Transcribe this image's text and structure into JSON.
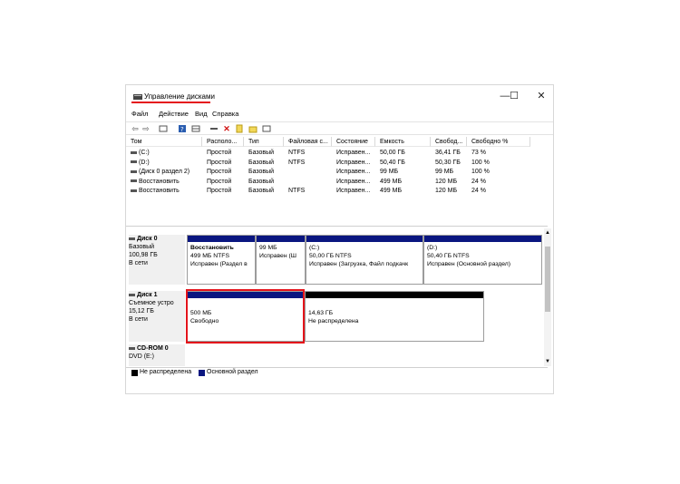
{
  "window": {
    "title": "Управление дисками",
    "controls": [
      "—",
      "☐",
      "✕"
    ]
  },
  "menu": [
    "Файл",
    "Действие",
    "Вид",
    "Справка"
  ],
  "toolbar": [
    "back-icon",
    "forward-icon",
    "properties-icon",
    "help-icon",
    "disk-list-icon",
    "connect-icon",
    "delete-icon",
    "new-icon",
    "folder-icon",
    "view-icon"
  ],
  "volume_table": {
    "headers": [
      "Том",
      "Располо...",
      "Тип",
      "Файловая с...",
      "Состояние",
      "Емкость",
      "Свобод...",
      "Свободно %"
    ],
    "rows": [
      [
        "(C:)",
        "Простой",
        "Базовый",
        "NTFS",
        "Исправен...",
        "50,00 ГБ",
        "36,41 ГБ",
        "73 %"
      ],
      [
        "(D:)",
        "Простой",
        "Базовый",
        "NTFS",
        "Исправен...",
        "50,40 ГБ",
        "50,30 ГБ",
        "100 %"
      ],
      [
        "(Диск 0 раздел 2)",
        "Простой",
        "Базовый",
        "",
        "Исправен...",
        "99 МБ",
        "99 МБ",
        "100 %"
      ],
      [
        "Восстановить",
        "Простой",
        "Базовый",
        "",
        "Исправен...",
        "499 МБ",
        "120 МБ",
        "24 %"
      ],
      [
        "Восстановить",
        "Простой",
        "Базовый",
        "NTFS",
        "Исправен...",
        "499 МБ",
        "120 МБ",
        "24 %"
      ]
    ]
  },
  "disks": [
    {
      "lines": [
        "Диск 0",
        "Базовый",
        "100,98 ГБ",
        "В сети"
      ],
      "partitions": [
        {
          "title": "Восстановить",
          "line1": "499 МБ NTFS",
          "line2": "Исправен (Раздел в"
        },
        {
          "title": "",
          "line1": "99 МБ",
          "line2": "Исправен (Ш"
        },
        {
          "title": "(C:)",
          "line1": "50,00 ГБ NTFS",
          "line2": "Исправен (Загрузка, Файл подкачк"
        },
        {
          "title": "(D:)",
          "line1": "50,40 ГБ NTFS",
          "line2": "Исправен (Основной раздел)"
        }
      ]
    },
    {
      "lines": [
        "Диск 1",
        "Съемное устро",
        "15,12 ГБ",
        "В сети"
      ],
      "partitions": [
        {
          "title": "",
          "line1": "500 МБ",
          "line2": "Свободно"
        },
        {
          "title": "",
          "line1": "14,63 ГБ",
          "line2": "Не распределена"
        }
      ]
    },
    {
      "lines": [
        "CD-ROM 0",
        "DVD (E:)"
      ]
    }
  ],
  "legend": [
    "Не распределена",
    "Основной раздел"
  ],
  "colors": {
    "primary": "#0a1680",
    "unallocated": "#000000",
    "highlight": "#e4141b",
    "free_space": "#8bc34a"
  }
}
